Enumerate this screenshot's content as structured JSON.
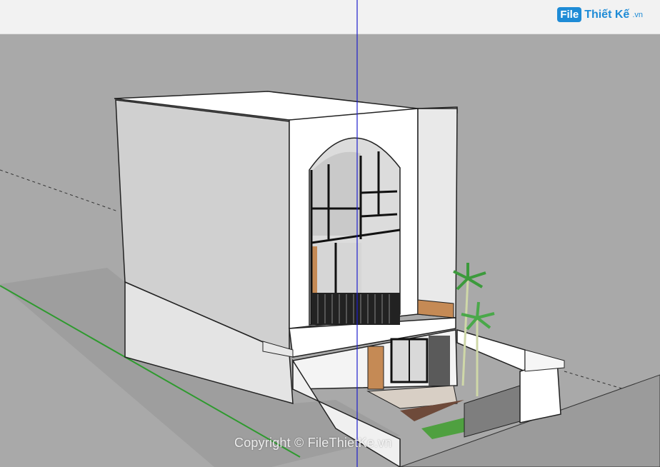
{
  "watermark": {
    "logo_badge": "File",
    "logo_name": "Thiết Kế",
    "logo_tld": ".vn",
    "copyright": "Copyright © FileThietKe.vn"
  },
  "scene": {
    "sky_color": "#f2f2f2",
    "ground_color": "#a9a9a9",
    "green_axis_color": "#2e9a2e",
    "blue_axis_color": "#1e1ecc",
    "wall_color": "#ffffff",
    "shade_color": "#c9c9c9"
  }
}
